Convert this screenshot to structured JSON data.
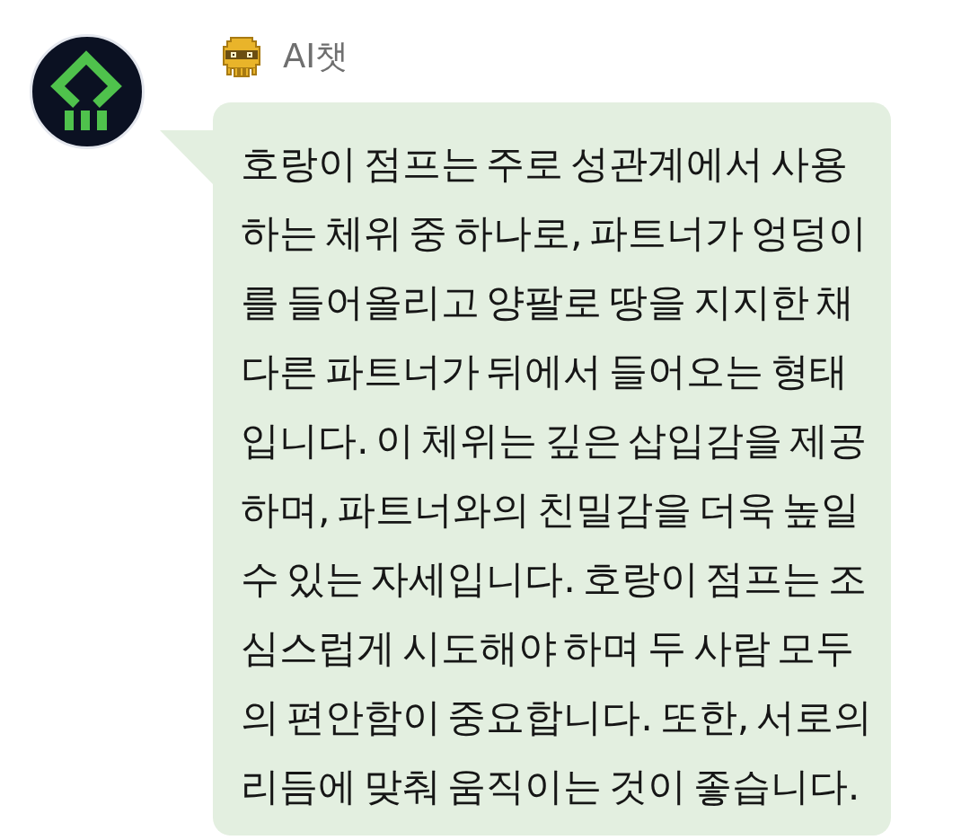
{
  "message": {
    "sender": {
      "name": "AI챗"
    },
    "text": "호랑이 점프는 주로 성관계에서 사용하는 체위 중 하나로, 파트너가 엉덩이를 들어올리고 양팔로 땅을 지지한 채 다른 파트너가 뒤에서 들어오는 형태입니다. 이 체위는 깊은 삽입감을 제공하며, 파트너와의 친밀감을 더욱 높일 수 있는 자세입니다. 호랑이 점프는 조심스럽게 시도해야 하며 두 사람 모두의 편안함이 중요합니다. 또한, 서로의 리듬에 맞춰 움직이는 것이 좋습니다."
  }
}
